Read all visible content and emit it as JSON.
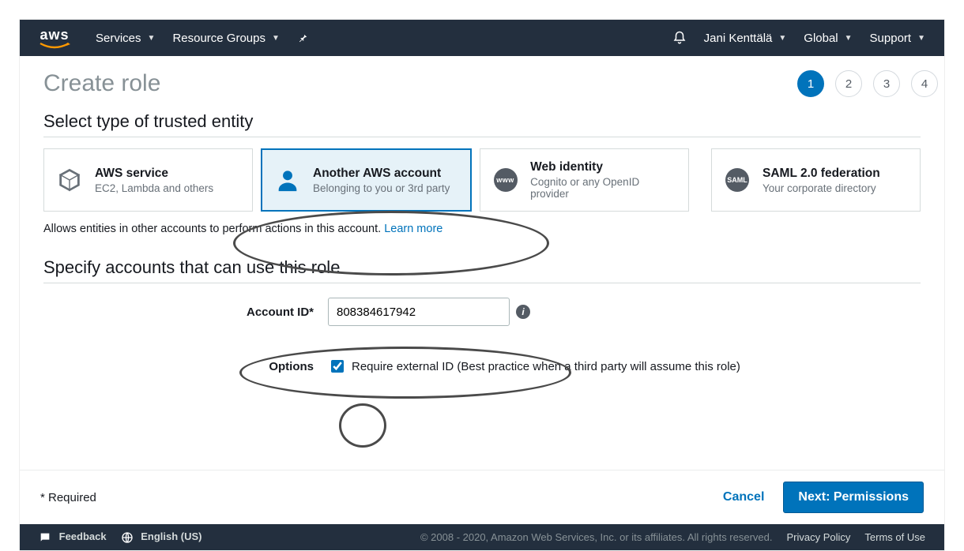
{
  "topbar": {
    "services": "Services",
    "resource_groups": "Resource Groups",
    "user": "Jani Kenttälä",
    "region": "Global",
    "support": "Support"
  },
  "page": {
    "title": "Create role",
    "steps": [
      "1",
      "2",
      "3",
      "4"
    ],
    "section_entity": "Select type of trusted entity",
    "section_accounts": "Specify accounts that can use this role",
    "desc": "Allows entities in other accounts to perform actions in this account. ",
    "learn_more": "Learn more"
  },
  "entities": [
    {
      "title": "AWS service",
      "sub": "EC2, Lambda and others"
    },
    {
      "title": "Another AWS account",
      "sub": "Belonging to you or 3rd party"
    },
    {
      "title": "Web identity",
      "sub": "Cognito or any OpenID provider"
    },
    {
      "title": "SAML 2.0 federation",
      "sub": "Your corporate directory"
    }
  ],
  "form": {
    "account_id_label": "Account ID*",
    "account_id_value": "808384617942",
    "options_label": "Options",
    "require_external_id": "Require external ID (Best practice when a third party will assume this role)",
    "require_external_id_checked": true
  },
  "bottom": {
    "required": "* Required",
    "cancel": "Cancel",
    "next": "Next: Permissions"
  },
  "footer": {
    "feedback": "Feedback",
    "language": "English (US)",
    "copyright": "© 2008 - 2020, Amazon Web Services, Inc. or its affiliates. All rights reserved.",
    "privacy": "Privacy Policy",
    "terms": "Terms of Use"
  }
}
